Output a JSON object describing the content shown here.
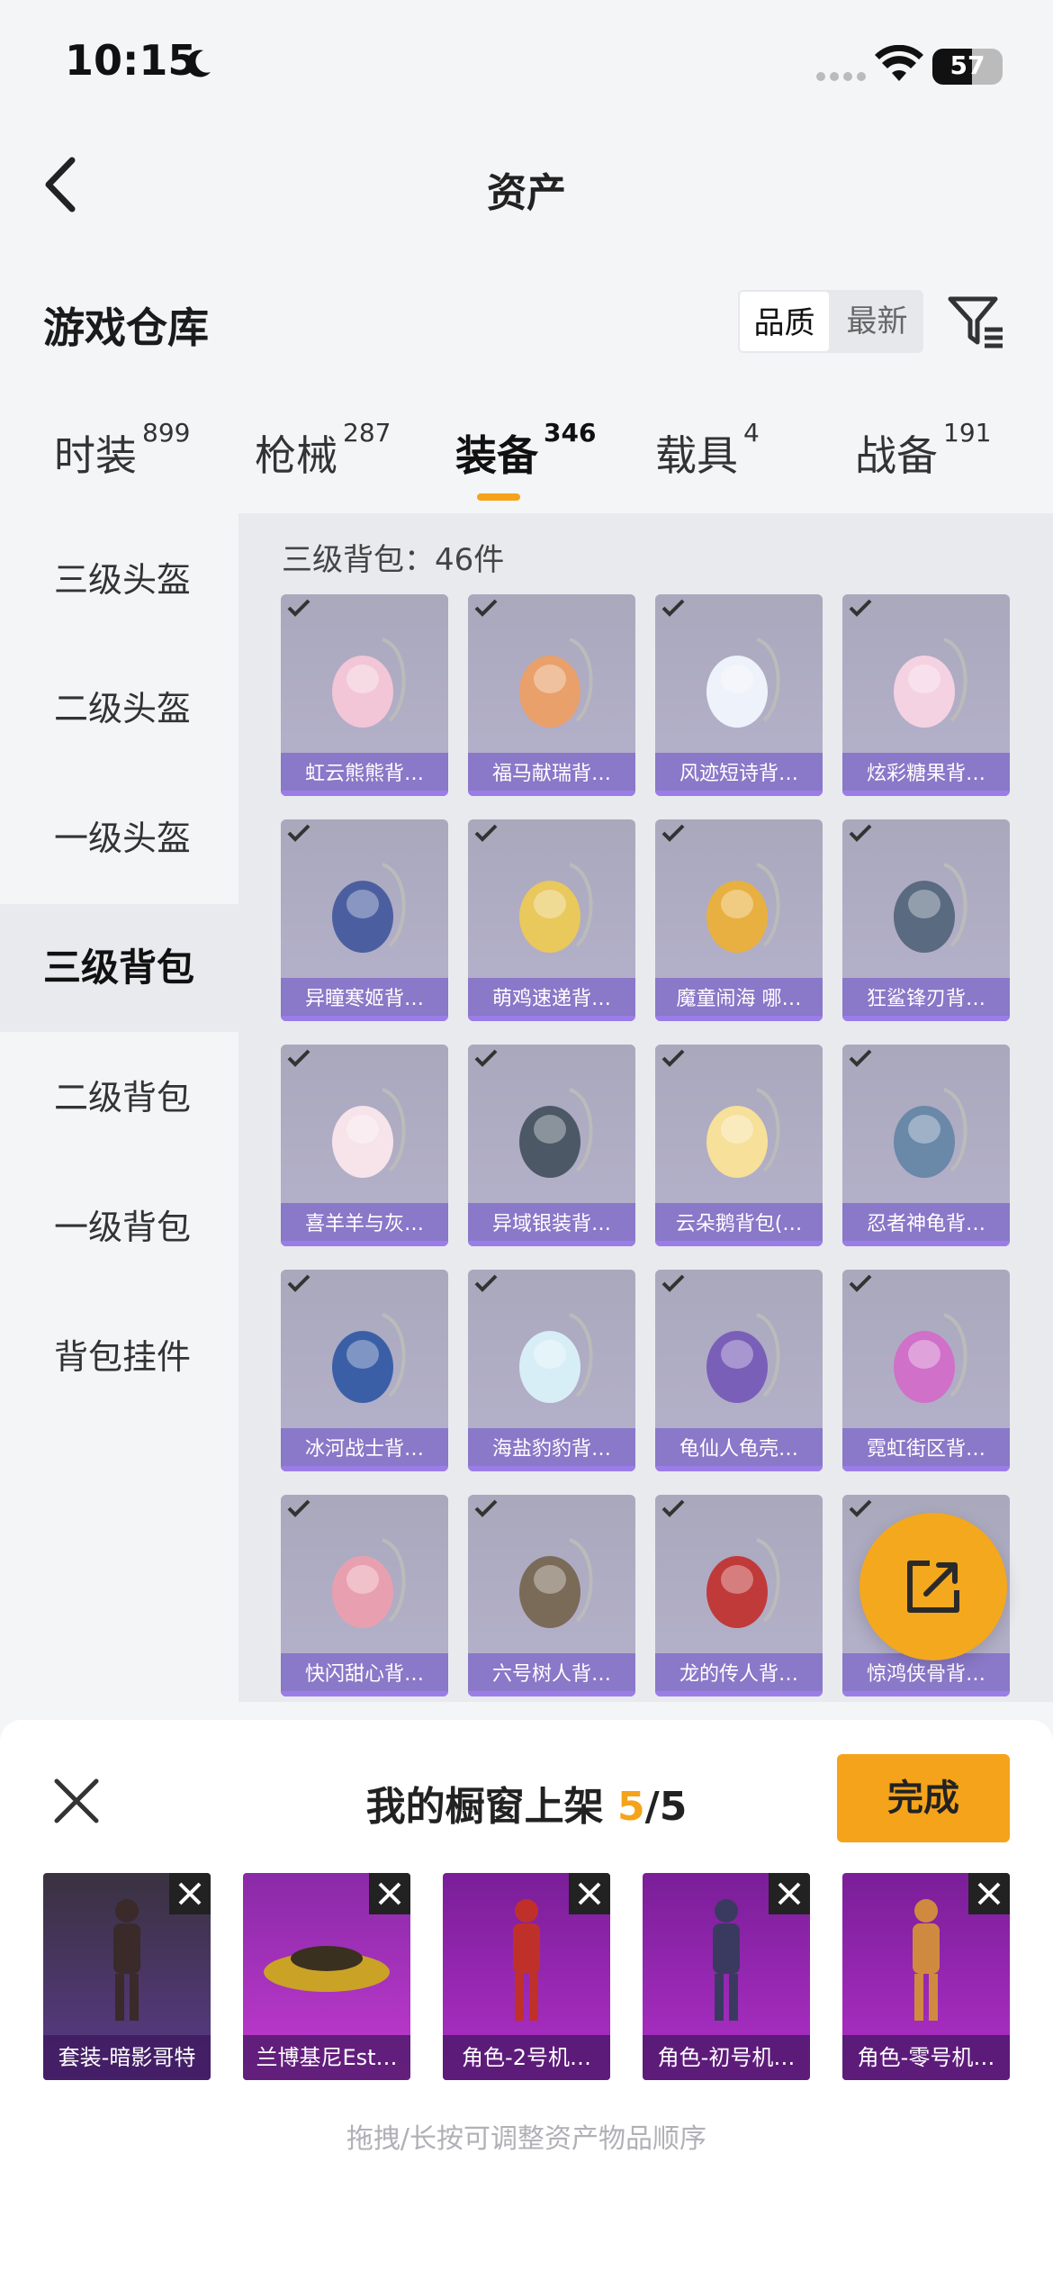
{
  "status": {
    "time": "10:15",
    "battery": "57",
    "battery_level": 0.57
  },
  "nav": {
    "title": "资产"
  },
  "header": {
    "title": "游戏仓库",
    "sort_options": [
      "品质",
      "最新"
    ],
    "sort_active": "品质"
  },
  "tabs": [
    {
      "label": "时装",
      "count": "899"
    },
    {
      "label": "枪械",
      "count": "287"
    },
    {
      "label": "装备",
      "count": "346",
      "active": true
    },
    {
      "label": "载具",
      "count": "4"
    },
    {
      "label": "战备",
      "count": "191"
    }
  ],
  "sidebar": {
    "items": [
      "三级头盔",
      "二级头盔",
      "一级头盔",
      "三级背包",
      "二级背包",
      "一级背包",
      "背包挂件"
    ],
    "active": "三级背包"
  },
  "grid": {
    "count_label": "三级背包：46件",
    "items": [
      "虹云熊熊背…",
      "福马献瑞背…",
      "风迹短诗背…",
      "炫彩糖果背…",
      "异瞳寒姬背…",
      "萌鸡速递背…",
      "魔童闹海 哪…",
      "狂鲨锋刃背…",
      "喜羊羊与灰…",
      "异域银装背…",
      "云朵鹅背包(…",
      "忍者神龟背…",
      "冰河战士背…",
      "海盐豹豹背…",
      "龟仙人龟壳…",
      "霓虹街区背…",
      "快闪甜心背…",
      "六号树人背…",
      "龙的传人背…",
      "惊鸿侠骨背…"
    ]
  },
  "panel": {
    "title_prefix": "我的橱窗上架",
    "count_current": "5",
    "count_total": "/5",
    "done_label": "完成",
    "slots": [
      "套装-暗影哥特",
      "兰博基尼Est…",
      "角色-2号机…",
      "角色-初号机…",
      "角色-零号机…"
    ],
    "hint": "拖拽/长按可调整资产物品顺序"
  },
  "colors": {
    "accent": "#f5a31a",
    "purple": "#9b7de8"
  }
}
